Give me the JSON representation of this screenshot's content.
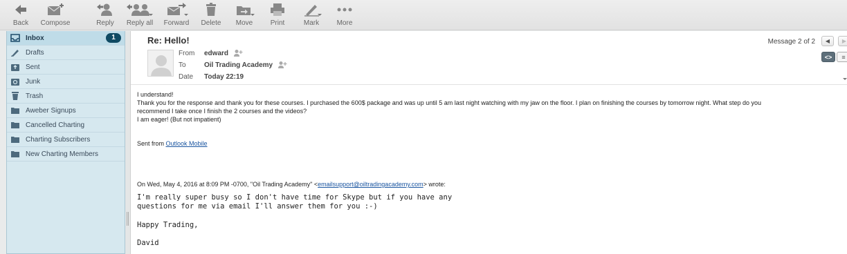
{
  "toolbar": {
    "back": "Back",
    "compose": "Compose",
    "reply": "Reply",
    "reply_all": "Reply all",
    "forward": "Forward",
    "delete": "Delete",
    "move": "Move",
    "print": "Print",
    "mark": "Mark",
    "more": "More"
  },
  "sidebar": {
    "folders": [
      {
        "label": "Inbox",
        "icon": "inbox-icon",
        "badge": "1"
      },
      {
        "label": "Drafts",
        "icon": "pencil-icon"
      },
      {
        "label": "Sent",
        "icon": "sent-icon"
      },
      {
        "label": "Junk",
        "icon": "junk-icon"
      },
      {
        "label": "Trash",
        "icon": "trash-icon"
      },
      {
        "label": "Aweber Signups",
        "icon": "folder-icon"
      },
      {
        "label": "Cancelled Charting",
        "icon": "folder-icon"
      },
      {
        "label": "Charting Subscribers",
        "icon": "folder-icon"
      },
      {
        "label": "New Charting Members",
        "icon": "folder-icon"
      }
    ]
  },
  "message": {
    "subject": "Re: Hello!",
    "from_label": "From",
    "from": "edward",
    "to_label": "To",
    "to": "Oil Trading Academy",
    "date_label": "Date",
    "date": "Today 22:19",
    "counter": "Message 2 of 2",
    "body": {
      "line1": "I understand!",
      "line2": "Thank you for the response and thank you for these courses. I purchased the 600$ package and was up until 5 am last night watching with my jaw on the floor. I plan on finishing the courses by tomorrow night. What step do you",
      "line3": "recommend I take once I finish the 2 courses and the videos?",
      "line4": "I am eager! (But not impatient)",
      "sent_from_prefix": "Sent from ",
      "sent_from_link": "Outlook Mobile",
      "quote_header_prefix": "On Wed, May 4, 2016 at 8:09 PM -0700, \"Oil Trading Academy\" <",
      "quote_email": "emailsupport@oiltradingacademy.com",
      "quote_header_suffix": "> wrote:",
      "quote_line1": "I'm really super busy so I don't have time for Skype but if you have any",
      "quote_line2": "questions for me via email I'll answer them for you :-)",
      "quote_line3": "Happy Trading,",
      "quote_line4": "David"
    }
  },
  "colors": {
    "sidebar_bg": "#d6e8ef",
    "badge_bg": "#0f4a63",
    "link": "#1a55a0"
  }
}
